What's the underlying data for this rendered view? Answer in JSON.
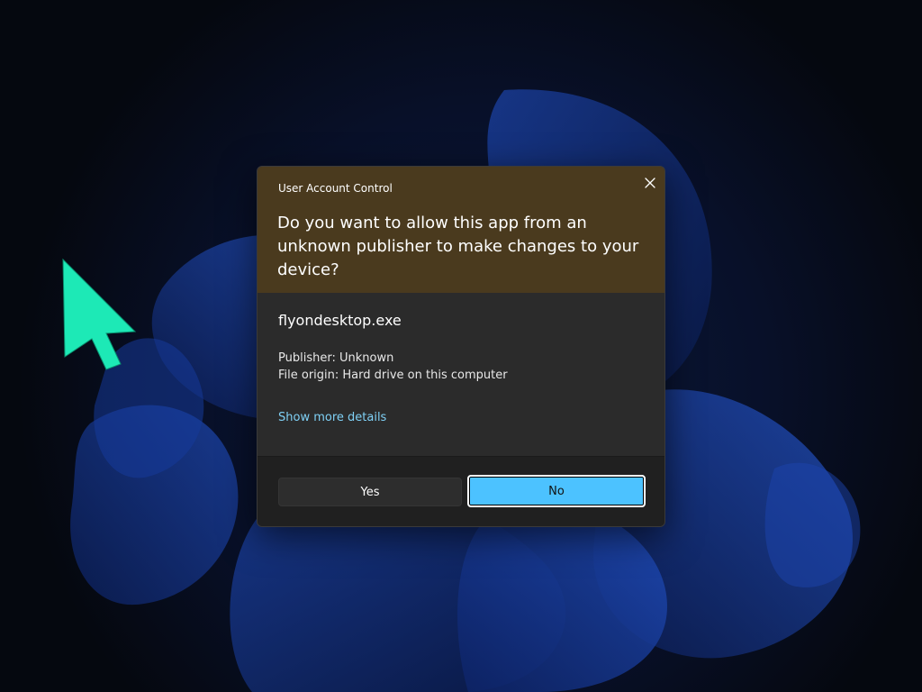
{
  "dialog": {
    "caption": "User Account Control",
    "question": "Do you want to allow this app from an unknown publisher to make changes to your device?",
    "app_name": "flyondesktop.exe",
    "publisher": "Publisher: Unknown",
    "file_origin": "File origin: Hard drive on this computer",
    "details_link": "Show more details",
    "yes_label": "Yes",
    "no_label": "No"
  },
  "icons": {
    "close": "close-icon",
    "cursor": "mouse-pointer-icon"
  },
  "colors": {
    "header_background": "#4a3a1e",
    "body_background": "#2b2b2b",
    "footer_background": "#202020",
    "accent": "#4cc2ff",
    "link": "#7fd0f5",
    "cursor": "#1de9b6",
    "wallpaper_base": "#070b18"
  }
}
